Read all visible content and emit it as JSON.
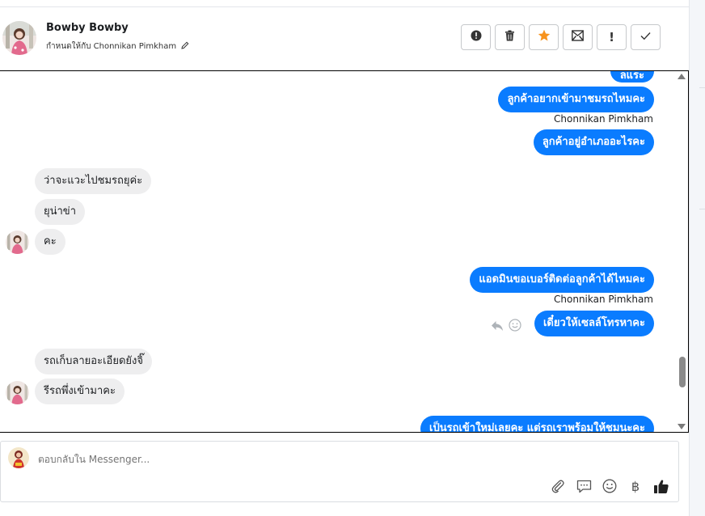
{
  "header": {
    "name": "Bowby Bowby",
    "assigned_prefix": "กำหนดให้กับ",
    "assigned_to": "Chonnikan Pimkham",
    "actions": [
      {
        "name": "spam-icon"
      },
      {
        "name": "trash-icon"
      },
      {
        "name": "star-icon"
      },
      {
        "name": "mark-unread-icon"
      },
      {
        "name": "exclamation-icon"
      },
      {
        "name": "check-icon"
      }
    ]
  },
  "chat": {
    "partial_top": "ลแระ",
    "messages": [
      {
        "dir": "out",
        "text": "ลูกค้าอยากเข้ามาชมรถไหมคะ"
      },
      {
        "dir": "sender",
        "text": "Chonnikan Pimkham"
      },
      {
        "dir": "out",
        "text": "ลูกค้าอยู่อำเภออะไรคะ"
      },
      {
        "dir": "in",
        "text": "ว่าจะแวะไปชมรถยุค่ะ"
      },
      {
        "dir": "in",
        "text": "ยุน่าข่า"
      },
      {
        "dir": "in",
        "text": "คะ"
      },
      {
        "dir": "out",
        "text": "แอดมินขอเบอร์ติดต่อลูกค้าได้ไหมคะ"
      },
      {
        "dir": "sender",
        "text": "Chonnikan Pimkham"
      },
      {
        "dir": "out",
        "text": "เดี๋ยวให้เซลล์โทรหาคะ"
      },
      {
        "dir": "in",
        "text": "รถเก็บลายอะเอียดยังจิ๊"
      },
      {
        "dir": "in",
        "text": "รีรถพึ่งเข้ามาคะ"
      },
      {
        "dir": "out",
        "text": "เป็นรถเข้าใหม่เลยคะ แต่รถเราพร้อมให้ชมนะคะ"
      }
    ]
  },
  "composer": {
    "placeholder": "ตอบกลับใน Messenger...",
    "tools": [
      "attach-icon",
      "saved-reply-icon",
      "emoji-icon",
      "baht-icon",
      "thumbs-up-icon"
    ]
  },
  "colors": {
    "accent": "#0a7cff",
    "incoming_bubble": "#eeeeef",
    "star": "#f7931e"
  }
}
